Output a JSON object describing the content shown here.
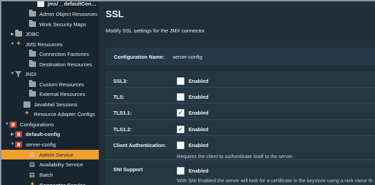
{
  "sidebar": {
    "items": [
      {
        "label": "jms/__defaultConnectionFa",
        "type": "jar",
        "indent": 40,
        "bold": true
      },
      {
        "label": "Admin Object Resources",
        "type": "folder",
        "indent": 28
      },
      {
        "label": "Work Security Maps",
        "type": "folder",
        "indent": 28
      },
      {
        "label": "JDBC",
        "type": "folder",
        "indent": 8,
        "twisty": "▶"
      },
      {
        "label": "JMS Resources",
        "type": "gear",
        "indent": 8,
        "twisty": "▼"
      },
      {
        "label": "Connection Factories",
        "type": "folder",
        "indent": 28
      },
      {
        "label": "Destination Resources",
        "type": "folder",
        "indent": 28
      },
      {
        "label": "JNDI",
        "type": "funnel",
        "indent": 8,
        "twisty": "▼"
      },
      {
        "label": "Custom Resources",
        "type": "folder",
        "indent": 28
      },
      {
        "label": "External Resources",
        "type": "folder",
        "indent": 28
      },
      {
        "label": "JavaMail Sessions",
        "type": "sq",
        "indent": 20
      },
      {
        "label": "Resource Adapter Configs",
        "type": "gear",
        "indent": 20
      },
      {
        "label": "Configurations",
        "type": "cfg",
        "indent": 0,
        "twisty": "▼"
      },
      {
        "label": "default-config",
        "type": "cfg",
        "indent": 8,
        "twisty": "▶",
        "bold": true
      },
      {
        "label": "server-config",
        "type": "cfg",
        "indent": 8,
        "twisty": "▼"
      },
      {
        "label": "Admin Service",
        "type": "svc",
        "indent": 28,
        "selected": true
      },
      {
        "label": "Availability Service",
        "type": "svc",
        "indent": 28
      },
      {
        "label": "Batch",
        "type": "svc",
        "indent": 28
      },
      {
        "label": "Connector Service",
        "type": "gear",
        "indent": 28,
        "bold": true
      }
    ]
  },
  "main": {
    "title": "SSL",
    "subtitle": "Modify SSL settings for the JMX connector.",
    "config_label": "Configuration Name:",
    "config_value": "server-config",
    "fields": [
      {
        "label": "SSL3:",
        "checked": false,
        "option": "Enabled"
      },
      {
        "label": "TLS:",
        "checked": false,
        "option": "Enabled"
      },
      {
        "label": "TLS1.1:",
        "checked": true,
        "option": "Enabled"
      },
      {
        "label": "TLS1.2:",
        "checked": true,
        "option": "Enabled"
      },
      {
        "label": "Client Authentication:",
        "checked": false,
        "option": "Enabled",
        "help": "Requires the client to authenticate itself to the server."
      },
      {
        "label": "SNI Support",
        "checked": false,
        "option": "Enabled",
        "help": "With SNI Enabled the server will look for a certificate in the keystore using a nick name th"
      }
    ],
    "checkmark": "✓"
  }
}
